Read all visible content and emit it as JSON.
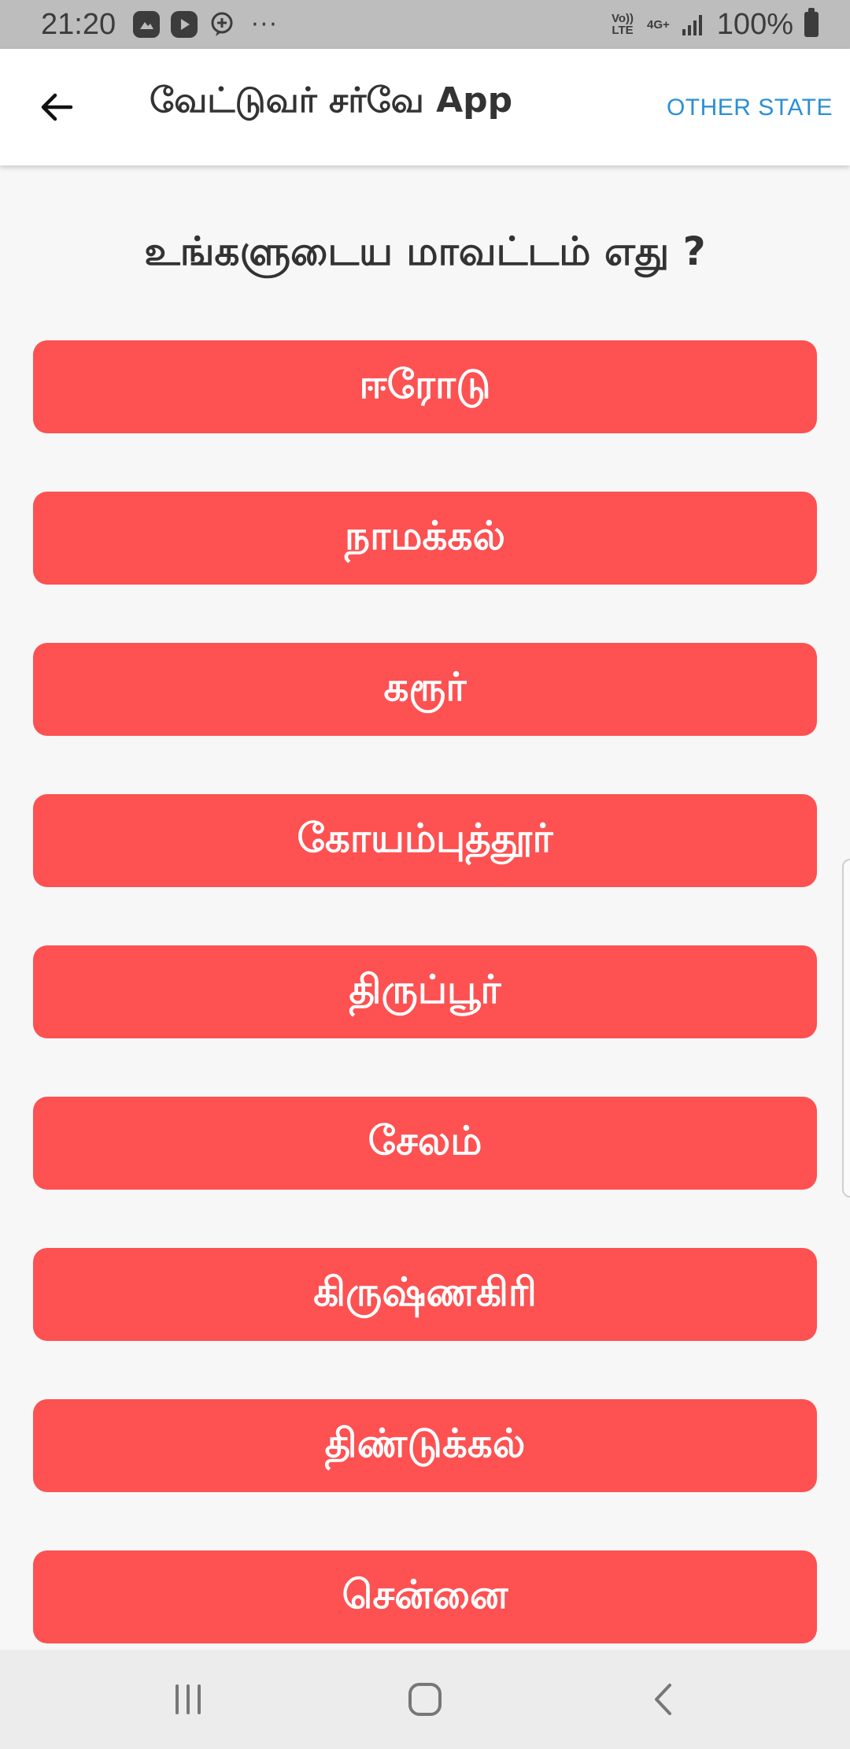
{
  "status_bar": {
    "time": "21:20",
    "dots": "···",
    "volte_label": "Vo)) LTE",
    "network_label": "4G+",
    "battery": "100%"
  },
  "app_bar": {
    "title": "வேட்டுவர் சர்வே App",
    "action": "OTHER STATE"
  },
  "question": "உங்களுடைய மாவட்டம் எது ?",
  "districts": [
    "ஈரோடு",
    "நாமக்கல்",
    "கரூர்",
    "கோயம்புத்தூர்",
    "திருப்பூர்",
    "சேலம்",
    "கிருஷ்ணகிரி",
    "திண்டுக்கல்",
    "சென்னை"
  ],
  "colors": {
    "accent": "#fd5152",
    "link": "#2b8fd6",
    "status_bar": "#bdbdbd",
    "background": "#f7f7f7"
  },
  "icons": {
    "back": "arrow-left-icon",
    "nav_recents": "recents-icon",
    "nav_home": "home-icon",
    "nav_back": "nav-back-icon"
  }
}
